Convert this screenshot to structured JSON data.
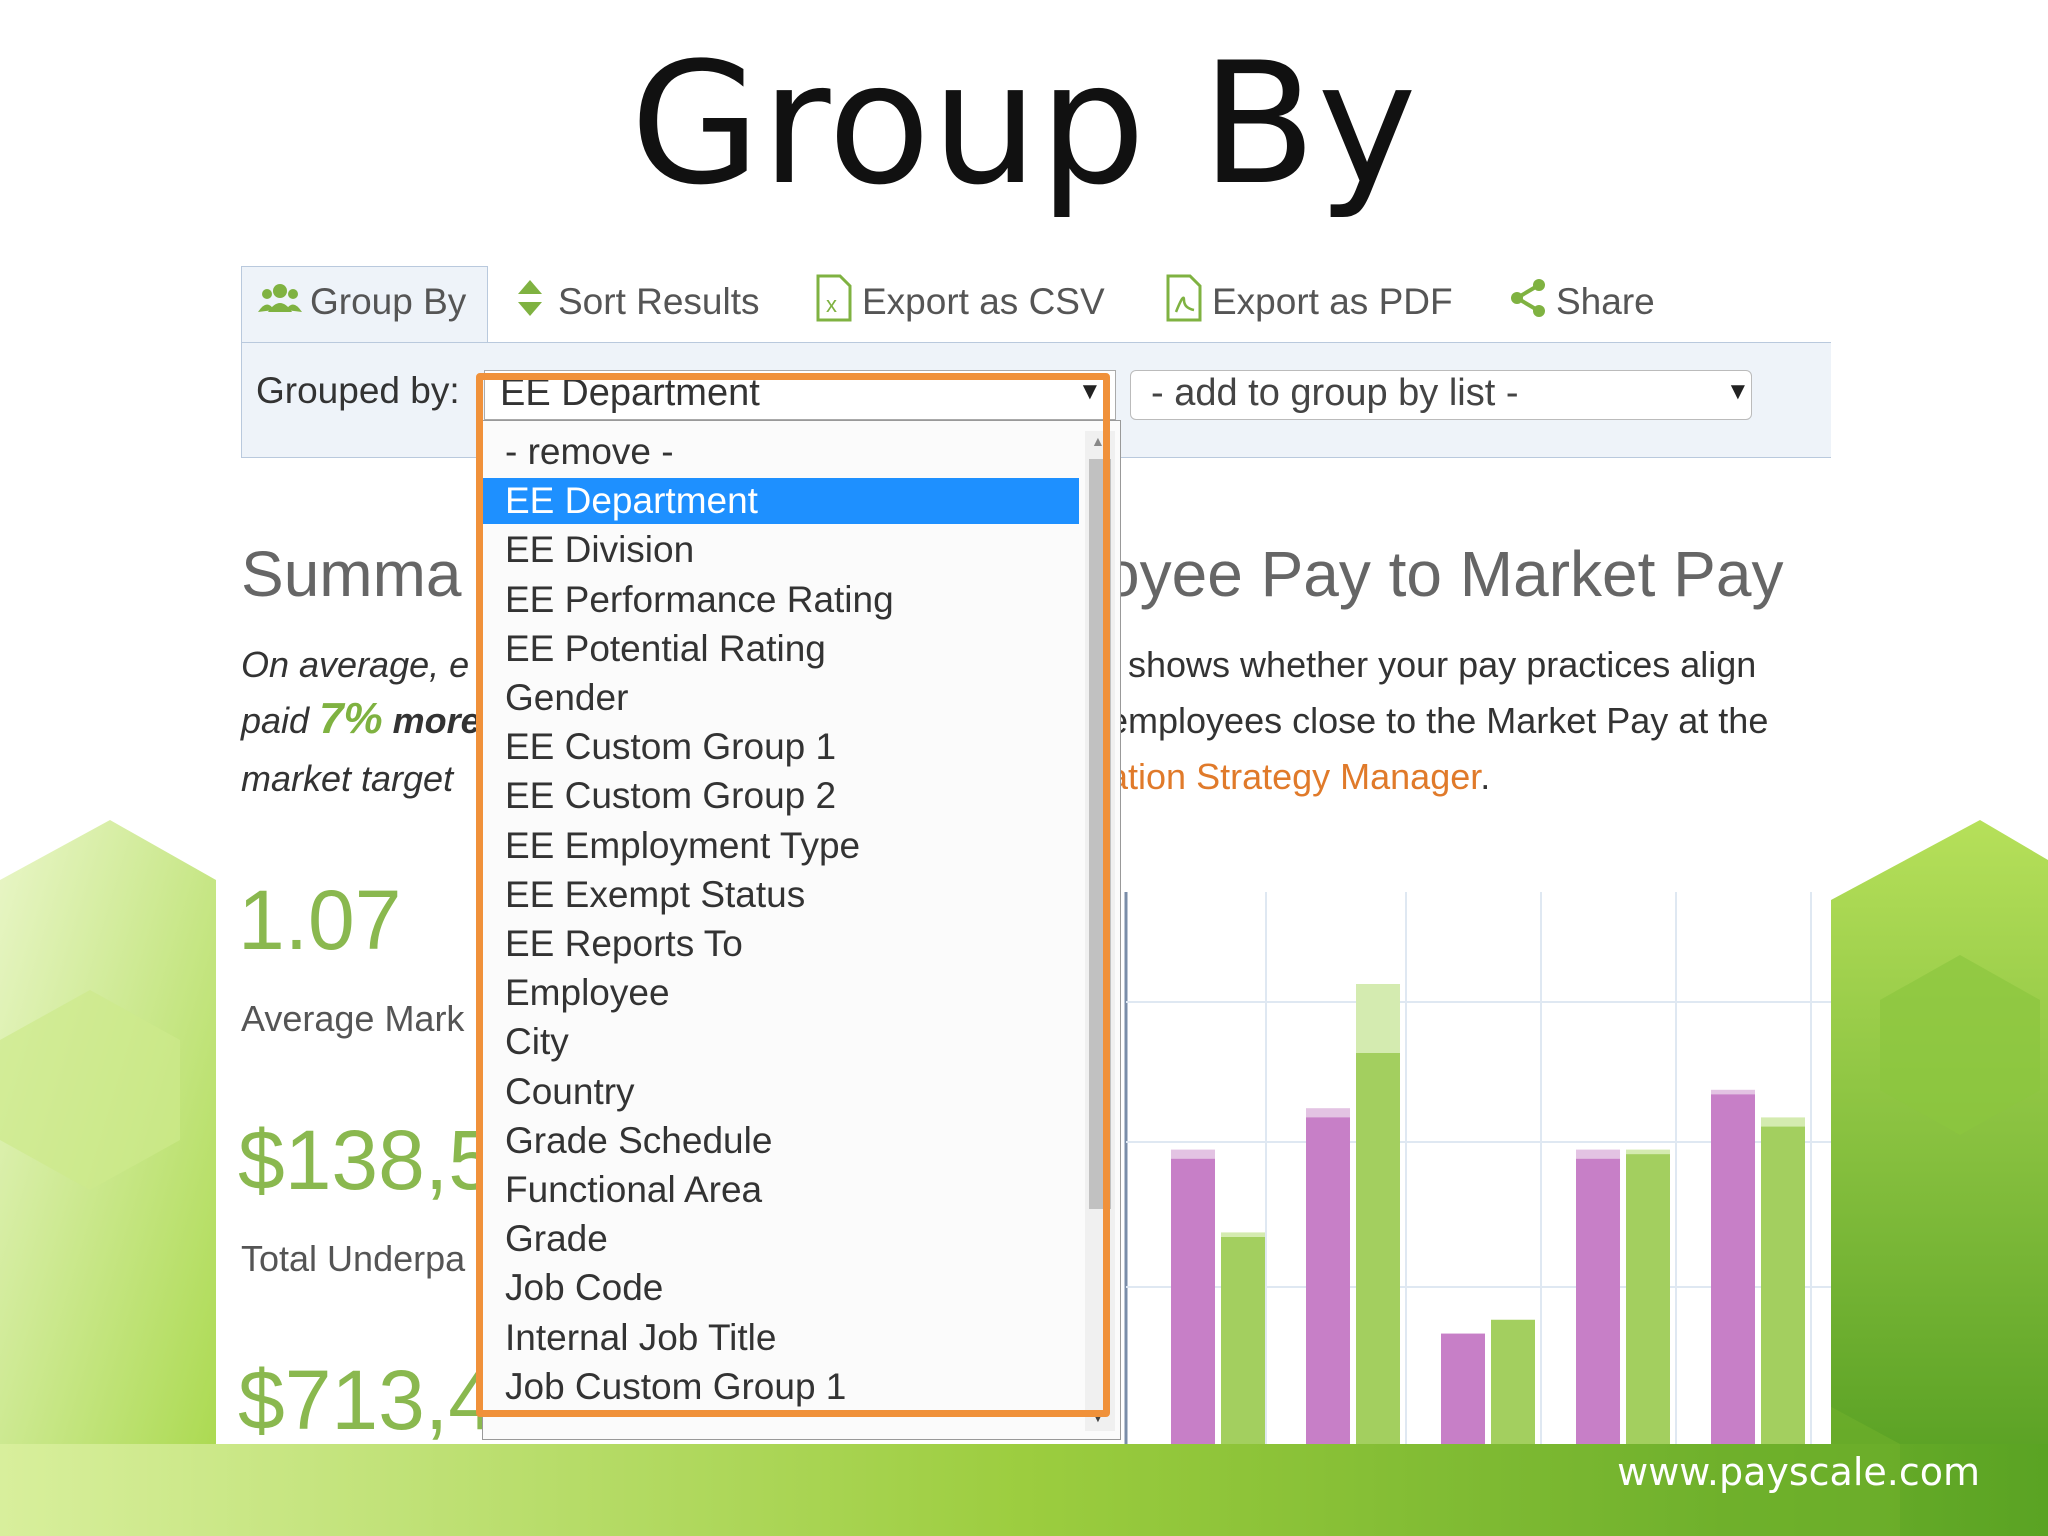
{
  "slide": {
    "title": "Group By",
    "footer_url": "www.payscale.com"
  },
  "toolbar": {
    "group_by": "Group By",
    "sort_results": "Sort Results",
    "export_csv": "Export as CSV",
    "export_pdf": "Export as PDF",
    "share": "Share"
  },
  "grouping": {
    "label": "Grouped by:",
    "selected": "EE Department",
    "add_placeholder": "- add to group by list -"
  },
  "dropdown": {
    "options": [
      "- remove -",
      "EE Department",
      "EE Division",
      "EE Performance Rating",
      "EE Potential Rating",
      "Gender",
      "EE Custom Group 1",
      "EE Custom Group 2",
      "EE Employment Type",
      "EE Exempt Status",
      "EE Reports To",
      "Employee",
      "City",
      "Country",
      "Grade Schedule",
      "Functional Area",
      "Grade",
      "Job Code",
      "Internal Job Title",
      "Job Custom Group 1"
    ],
    "selected_index": 1
  },
  "summary": {
    "title_left": "Summa",
    "title_right": "oyee Pay to Market Pay",
    "left_line1": "On average, e",
    "left_line2_a": "paid ",
    "left_line2_pct": "7%",
    "left_line2_b": " more",
    "left_line3": "market target",
    "right_line1": "t shows whether your pay practices align",
    "right_line2": "employees close to the Market Pay at the",
    "right_line3_link": "ation Strategy Manager",
    "right_line3_end": "."
  },
  "stats": {
    "stat1_value": "1.07",
    "stat1_label": "Average Mark",
    "stat2_value": "$138,5",
    "stat2_label": "Total Underpa",
    "stat3_value": "$713,4"
  },
  "colors": {
    "accent_orange": "#f0913a",
    "select_blue": "#1e90ff",
    "bar_purple": "#c77fc7",
    "bar_green": "#a3cf5f"
  },
  "chart_data": {
    "type": "bar",
    "series": [
      {
        "values": [
          0.62,
          0.71,
          0.24,
          0.62,
          0.76
        ]
      },
      {
        "values": [
          0.45,
          0.85,
          0.27,
          0.63,
          0.69
        ]
      }
    ],
    "overlay_values": [
      [
        0.64,
        0.73,
        0.24,
        0.64,
        0.77
      ],
      [
        0.46,
        1.0,
        0.27,
        0.64,
        0.71
      ]
    ]
  }
}
